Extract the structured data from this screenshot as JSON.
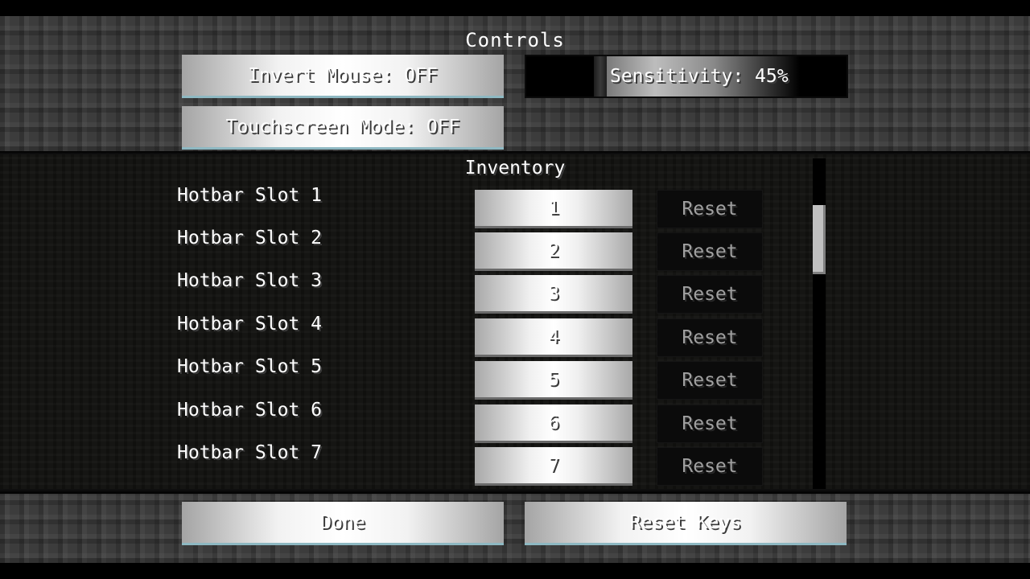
{
  "screen": {
    "title": "Controls",
    "invert_mouse": "Invert Mouse: OFF",
    "sensitivity": {
      "label": "Sensitivity: 45%",
      "value_percent": 45
    },
    "touchscreen": "Touchscreen Mode: OFF"
  },
  "list": {
    "category": "Inventory",
    "reset_label": "Reset",
    "rows": [
      {
        "label": "Hotbar Slot 1",
        "key": "1"
      },
      {
        "label": "Hotbar Slot 2",
        "key": "2"
      },
      {
        "label": "Hotbar Slot 3",
        "key": "3"
      },
      {
        "label": "Hotbar Slot 4",
        "key": "4"
      },
      {
        "label": "Hotbar Slot 5",
        "key": "5"
      },
      {
        "label": "Hotbar Slot 6",
        "key": "6"
      },
      {
        "label": "Hotbar Slot 7",
        "key": "7"
      }
    ]
  },
  "footer": {
    "done": "Done",
    "reset_keys": "Reset Keys"
  },
  "colors": {
    "button_accent": "#8eb8c2",
    "text": "#ffffff",
    "reset_text": "#a0a0a0"
  }
}
